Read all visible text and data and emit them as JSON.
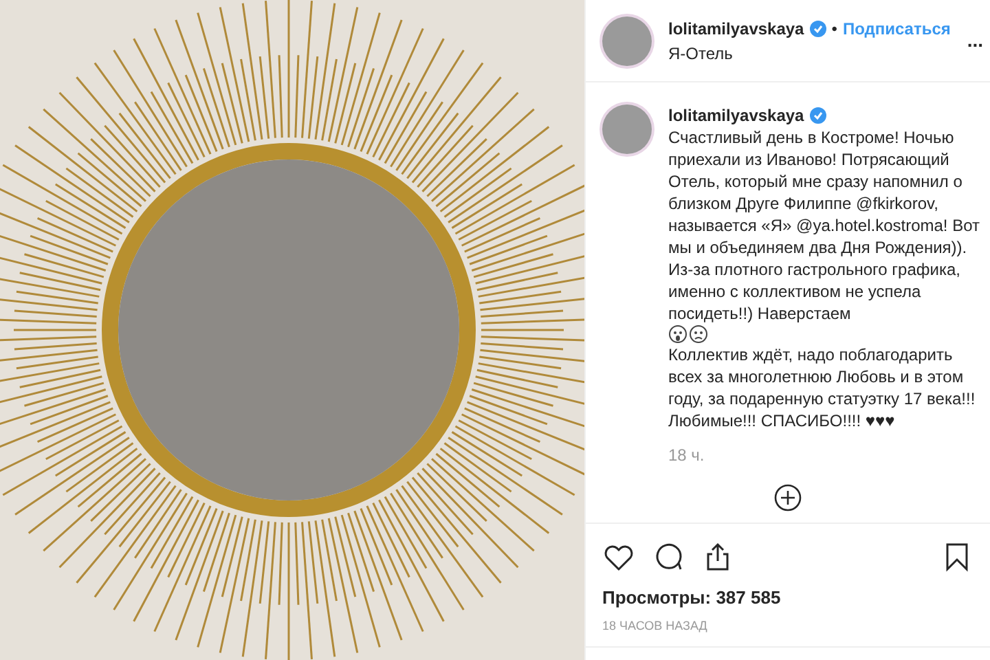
{
  "post_header": {
    "username": "lolitamilyavskaya",
    "separator": "•",
    "follow_button": "Подписаться",
    "location": "Я-Отель",
    "more": "..."
  },
  "caption": {
    "username": "lolitamilyavskaya",
    "text_before": "Счастливый день в Костроме! Ночью приехали из Иваново! Потрясающий Отель, который мне сразу напомнил о близком Друге Филиппе @fkirkorov, называется «Я» @ya.hotel.kostroma! Вот мы и объединяем два Дня Рождения)). Из-за плотного гастрольного графика, именно с коллективом не успела посидеть!!) Наверстаем",
    "text_after": "Коллектив ждёт, надо поблагодарить всех за многолетнюю Любовь и в этом году, за подаренную статуэтку 17 века!!! Любимые!!! СПАСИБО!!!! ♥♥♥",
    "time": "18 ч."
  },
  "views": "Просмотры: 387 585",
  "posted": "18 ЧАСОВ НАЗАД"
}
